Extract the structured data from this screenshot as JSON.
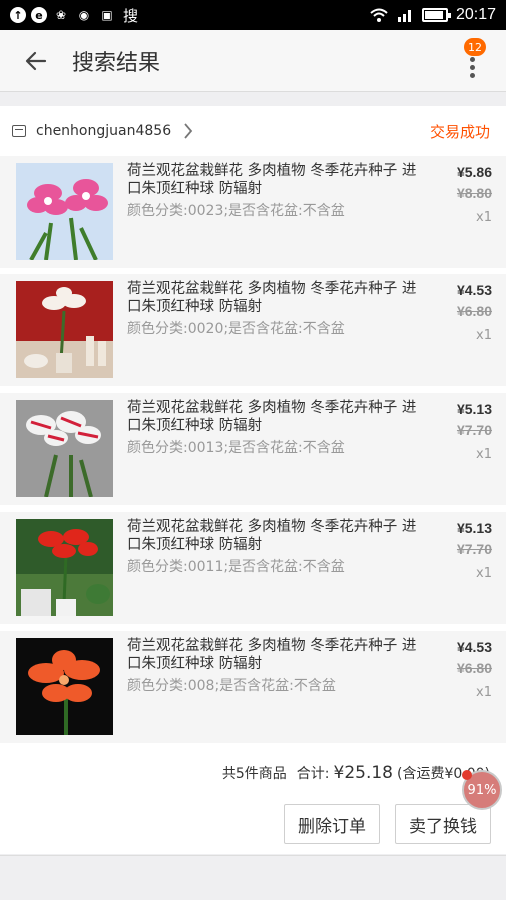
{
  "status_bar": {
    "carrier_char": "搜",
    "time": "20:17",
    "battery_level": 0.85
  },
  "header": {
    "title": "搜索结果",
    "notification_count": "12"
  },
  "order": {
    "shop_name": "chenhongjuan4856",
    "status": "交易成功",
    "items": [
      {
        "title": "荷兰观花盆栽鲜花 多肉植物 冬季花卉种子 进口朱顶红种球 防辐射",
        "spec": "颜色分类:0023;是否含花盆:不含盆",
        "price": "¥5.86",
        "original_price": "¥8.80",
        "quantity": "x1"
      },
      {
        "title": "荷兰观花盆栽鲜花 多肉植物 冬季花卉种子 进口朱顶红种球 防辐射",
        "spec": "颜色分类:0020;是否含花盆:不含盆",
        "price": "¥4.53",
        "original_price": "¥6.80",
        "quantity": "x1"
      },
      {
        "title": "荷兰观花盆栽鲜花 多肉植物 冬季花卉种子 进口朱顶红种球 防辐射",
        "spec": "颜色分类:0013;是否含花盆:不含盆",
        "price": "¥5.13",
        "original_price": "¥7.70",
        "quantity": "x1"
      },
      {
        "title": "荷兰观花盆栽鲜花 多肉植物 冬季花卉种子 进口朱顶红种球 防辐射",
        "spec": "颜色分类:0011;是否含花盆:不含盆",
        "price": "¥5.13",
        "original_price": "¥7.70",
        "quantity": "x1"
      },
      {
        "title": "荷兰观花盆栽鲜花 多肉植物 冬季花卉种子 进口朱顶红种球 防辐射",
        "spec": "颜色分类:008;是否含花盆:不含盆",
        "price": "¥4.53",
        "original_price": "¥6.80",
        "quantity": "x1"
      }
    ],
    "summary_count": "共5件商品",
    "total_label": "合计:",
    "total_amount": "¥25.18",
    "shipping": "(含运费¥0.00)"
  },
  "actions": {
    "delete_order": "删除订单",
    "sell_for_cash": "卖了换钱"
  },
  "floating_widget": {
    "percent": "91%"
  },
  "colors": {
    "accent": "#ff5000",
    "badge": "#ff6a00"
  }
}
